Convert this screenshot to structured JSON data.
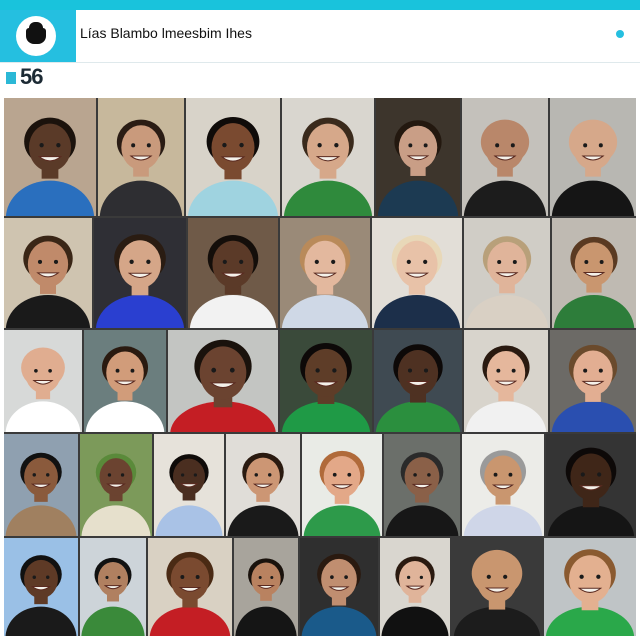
{
  "app": {
    "title": "Lías Blambo lmeesbim Ihes"
  },
  "participants": {
    "count": "56"
  },
  "colors": {
    "accent": "#25bfe0",
    "header_strip": "#19c3dc"
  },
  "tiles": [
    {
      "bg": "#b9a590",
      "skin": "#5a3a28",
      "shirt": "#2a6fbe",
      "hair": "#1b120c"
    },
    {
      "bg": "#c7b89c",
      "skin": "#c99a7c",
      "shirt": "#2e2e32",
      "hair": "#2a1c14"
    },
    {
      "bg": "#d8d3c9",
      "skin": "#7a4a30",
      "shirt": "#9fd3e0",
      "hair": "#0f0b09"
    },
    {
      "bg": "#d9d6cf",
      "skin": "#d6a88a",
      "shirt": "#2f8a3c",
      "hair": "#3a2a1c"
    },
    {
      "bg": "#3d352c",
      "skin": "#c99e86",
      "shirt": "#1c3a52",
      "hair": "#23180f"
    },
    {
      "bg": "#c4c1bb",
      "skin": "#b9876a",
      "shirt": "#1c1c1c",
      "hair": "#b9876a"
    },
    {
      "bg": "#b8b7b2",
      "skin": "#d6a88a",
      "shirt": "#151515",
      "hair": "#d6a88a"
    },
    {
      "bg": "#cfc4b0",
      "skin": "#c08a6a",
      "shirt": "#1a1a1a",
      "hair": "#3a2616"
    },
    {
      "bg": "#2f2f35",
      "skin": "#d5a688",
      "shirt": "#2a3fd0",
      "hair": "#2a1c12"
    },
    {
      "bg": "#6f5a48",
      "skin": "#5b3a28",
      "shirt": "#f2f2f2",
      "hair": "#140e0a"
    },
    {
      "bg": "#9a8a78",
      "skin": "#e3b89e",
      "shirt": "#cfd8e6",
      "hair": "#b98a5a"
    },
    {
      "bg": "#e2ded7",
      "skin": "#e8c2a8",
      "shirt": "#1c2f4a",
      "hair": "#e8d8b8"
    },
    {
      "bg": "#d0cdc6",
      "skin": "#e0b49a",
      "shirt": "#d9d0c4",
      "hair": "#b8a07a"
    },
    {
      "bg": "#bfbab2",
      "skin": "#c9966f",
      "shirt": "#2d7d3a",
      "hair": "#5a3a22"
    },
    {
      "bg": "#d7d9d8",
      "skin": "#e0ad90",
      "shirt": "#ffffff",
      "hair": "#e0ad90"
    },
    {
      "bg": "#6b7e7e",
      "skin": "#d19c7a",
      "shirt": "#ffffff",
      "hair": "#2a1a10"
    },
    {
      "bg": "#c3c5c2",
      "skin": "#6b4330",
      "shirt": "#c41e24",
      "hair": "#1a120c"
    },
    {
      "bg": "#3a4a3a",
      "skin": "#5e3d28",
      "shirt": "#1f9a46",
      "hair": "#0d0908"
    },
    {
      "bg": "#3f4a52",
      "skin": "#4e3122",
      "shirt": "#2b8f3e",
      "hair": "#0d0908"
    },
    {
      "bg": "#d8d4cc",
      "skin": "#e5b79c",
      "shirt": "#f1f1f1",
      "hair": "#2a1a10"
    },
    {
      "bg": "#6c6a66",
      "skin": "#e2ae92",
      "shirt": "#2a4fb0",
      "hair": "#6a4a2c"
    },
    {
      "bg": "#8fa0b0",
      "skin": "#8a5a3c",
      "shirt": "#a08060",
      "hair": "#111111"
    },
    {
      "bg": "#7c9a5a",
      "skin": "#6b4330",
      "shirt": "#e6e0cc",
      "hair": "#5a8a3a"
    },
    {
      "bg": "#e6e2da",
      "skin": "#4a2e20",
      "shirt": "#a9c2e6",
      "hair": "#0f0b09"
    },
    {
      "bg": "#e0ddd8",
      "skin": "#cc9674",
      "shirt": "#1a1a1a",
      "hair": "#2a1a10"
    },
    {
      "bg": "#e9ebe6",
      "skin": "#e3a888",
      "shirt": "#2d9a4a",
      "hair": "#b06a3a"
    },
    {
      "bg": "#6b6f6a",
      "skin": "#8a6048",
      "shirt": "#171717",
      "hair": "#2a2a2a"
    },
    {
      "bg": "#ecece8",
      "skin": "#c9966f",
      "shirt": "#cfd6e8",
      "hair": "#9a9a9a"
    },
    {
      "bg": "#343434",
      "skin": "#3f2618",
      "shirt": "#151515",
      "hair": "#0d0908"
    },
    {
      "bg": "#9ac0e6",
      "skin": "#5e3a26",
      "shirt": "#1a1a1a",
      "hair": "#111111"
    },
    {
      "bg": "#cdd4d9",
      "skin": "#b08060",
      "shirt": "#3a8a3a",
      "hair": "#111111"
    },
    {
      "bg": "#d9d1c3",
      "skin": "#7a4a30",
      "shirt": "#c41e24",
      "hair": "#4a2a14"
    },
    {
      "bg": "#a8a49c",
      "skin": "#b98260",
      "shirt": "#151515",
      "hair": "#1a120c"
    },
    {
      "bg": "#2f2f2f",
      "skin": "#c08e70",
      "shirt": "#1a5a8a",
      "hair": "#2a1a10"
    },
    {
      "bg": "#d9d6cf",
      "skin": "#e0b49a",
      "shirt": "#111111",
      "hair": "#2a1a10"
    },
    {
      "bg": "#3a3a3a",
      "skin": "#c9966f",
      "shirt": "#1c1c1c",
      "hair": "#c9966f"
    },
    {
      "bg": "#bfc4c6",
      "skin": "#e3b090",
      "shirt": "#2aa84a",
      "hair": "#8a5a30"
    }
  ]
}
